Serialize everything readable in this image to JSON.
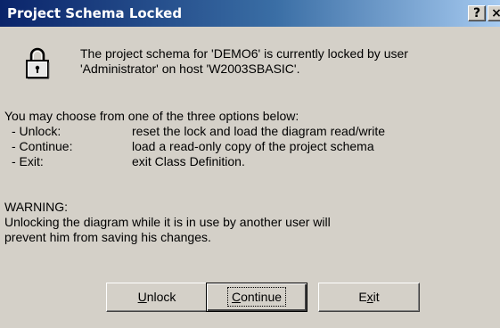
{
  "dialog": {
    "title": "Project Schema Locked",
    "help_label": "?",
    "close_label": "×",
    "icon": "lock-icon",
    "message_lines": [
      "The project schema for 'DEMO6' is currently locked by user",
      "'Administrator' on host 'W2003SBASIC'."
    ],
    "options_intro": "You may choose from one of the three options below:",
    "options": [
      {
        "key": "- Unlock:",
        "desc": "reset the lock and load the diagram read/write"
      },
      {
        "key": "- Continue:",
        "desc": "load a read-only copy of the project schema"
      },
      {
        "key": "- Exit:",
        "desc": "exit Class Definition."
      }
    ],
    "warning_heading": "WARNING:",
    "warning_lines": [
      "Unlocking the diagram while it is in use by another user will",
      "prevent him from saving his changes."
    ],
    "buttons": {
      "unlock": {
        "mnemonic": "U",
        "rest": "nlock"
      },
      "continue": {
        "mnemonic": "C",
        "rest": "ontinue"
      },
      "exit": {
        "pre": "E",
        "mnemonic": "x",
        "rest": "it"
      }
    }
  },
  "colors": {
    "titlebar_start": "#0a246a",
    "titlebar_end": "#a6caf0",
    "face": "#d4d0c8"
  }
}
